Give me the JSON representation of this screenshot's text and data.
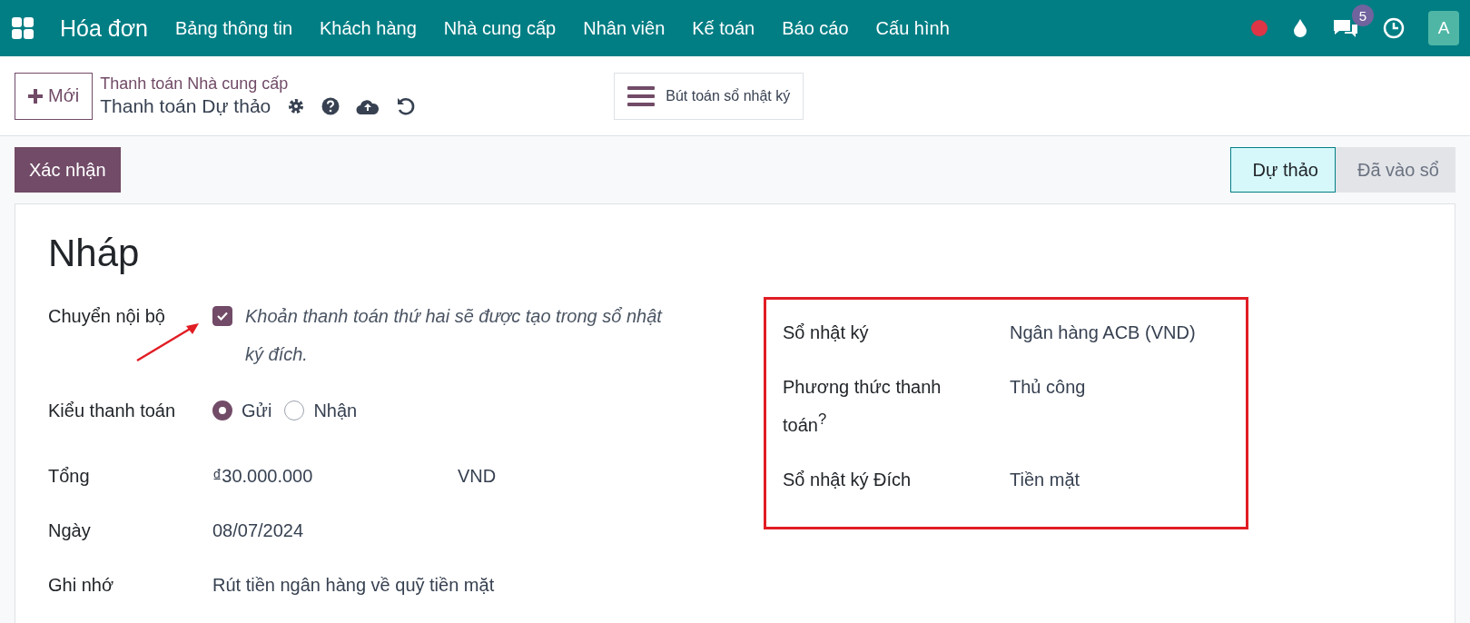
{
  "navbar": {
    "app_name": "Hóa đơn",
    "menu": [
      "Bảng thông tin",
      "Khách hàng",
      "Nhà cung cấp",
      "Nhân viên",
      "Kế toán",
      "Báo cáo",
      "Cấu hình"
    ],
    "message_count": "5",
    "avatar": "A"
  },
  "control_panel": {
    "new_button": "Mới",
    "breadcrumb": "Thanh toán Nhà cung cấp",
    "record_title": "Thanh toán Dự thảo",
    "journal_button": "Bút toán sổ nhật ký"
  },
  "actions": {
    "confirm_button": "Xác nhận",
    "status_steps": [
      {
        "label": "Dự thảo",
        "selected": true
      },
      {
        "label": "Đã vào sổ",
        "selected": false
      }
    ]
  },
  "sheet": {
    "title": "Nháp",
    "left_fields": [
      {
        "kind": "checkbox",
        "label": "Chuyển nội bộ",
        "checked": true,
        "note": "Khoản thanh toán thứ hai sẽ được tạo trong sổ nhật ký đích.",
        "pointed": true
      },
      {
        "kind": "radio",
        "label": "Kiểu thanh toán",
        "options": [
          {
            "label": "Gửi",
            "selected": true
          },
          {
            "label": "Nhận",
            "selected": false
          }
        ]
      },
      {
        "kind": "amount",
        "label": "Tổng",
        "value": "₫30.000.000",
        "currency": "VND"
      },
      {
        "kind": "text",
        "label": "Ngày",
        "value": "08/07/2024"
      },
      {
        "kind": "text",
        "label": "Ghi nhớ",
        "value": "Rút tiền ngân hàng về quỹ tiền mặt"
      }
    ],
    "right_group": {
      "highlighted": true,
      "fields": [
        {
          "label": "Sổ nhật ký",
          "value": "Ngân hàng ACB (VND)"
        },
        {
          "label": "Phương thức thanh toán$^{?}$",
          "value": "Thủ công"
        },
        {
          "label": "Sổ nhật ký Đích",
          "value": "Tiền mặt"
        }
      ]
    }
  }
}
